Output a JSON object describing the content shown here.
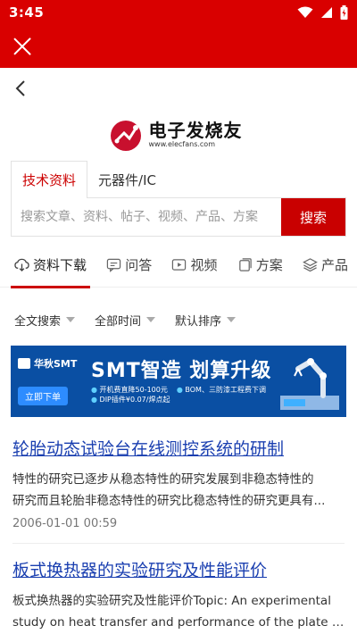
{
  "status": {
    "time": "3:45"
  },
  "logo": {
    "cn": "电子发烧友",
    "en": "www.elecfans.com"
  },
  "search": {
    "tabs": [
      "技术资料",
      "元器件/IC"
    ],
    "placeholder": "搜索文章、资料、帖子、视频、产品、方案",
    "button": "搜索"
  },
  "categories": [
    {
      "label": "资料下载",
      "icon": "cloud-download-icon"
    },
    {
      "label": "问答",
      "icon": "chat-icon"
    },
    {
      "label": "视频",
      "icon": "video-icon"
    },
    {
      "label": "方案",
      "icon": "copy-icon"
    },
    {
      "label": "产品",
      "icon": "layers-icon"
    }
  ],
  "filters": [
    "全文搜索",
    "全部时间",
    "默认排序"
  ],
  "banner": {
    "brand": "华秋SMT",
    "headline": "SMT智造 划算升级",
    "cta": "立即下单",
    "bullets": [
      "开机费直降50-100元",
      "BOM、三防漆工程费下调",
      "DIP插件¥0.07/焊点起"
    ]
  },
  "articles": [
    {
      "title": "轮胎动态试验台在线测控系统的研制",
      "desc1": "特性的研究已逐步从稳态特性的研究发展到非稳态特性的",
      "desc2": "研究而且轮胎非稳态特性的研究比稳态特性的研究更具有...",
      "date": "2006-01-01 00:59"
    },
    {
      "title": "板式换热器的实验研究及性能评价",
      "desc1": "板式换热器的实验研究及性能评价Topic: An experimental",
      "desc2": "study on heat transfer and performance of the plate heat..."
    }
  ],
  "colors": {
    "brand_red": "#d90000",
    "link_blue": "#1a3fb0"
  }
}
